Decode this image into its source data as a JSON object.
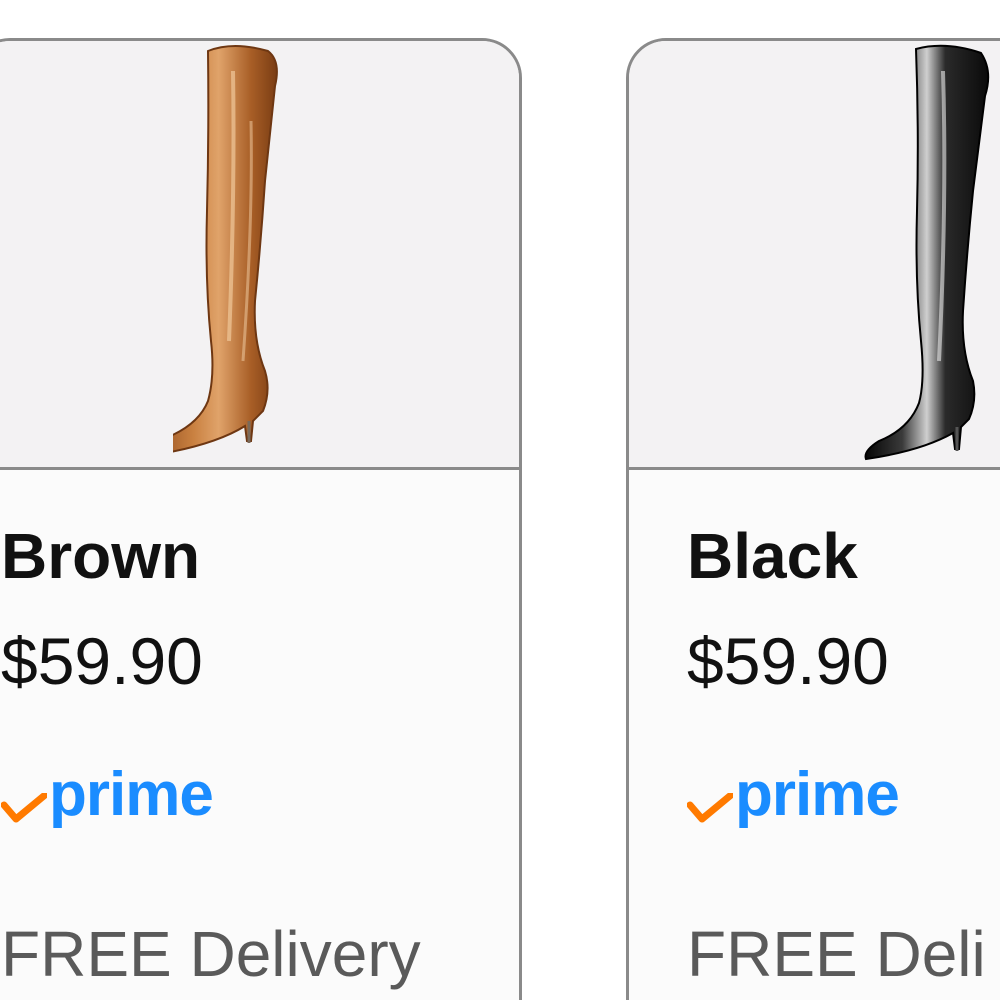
{
  "variants": [
    {
      "color_name": "Brown",
      "price": "$59.90",
      "prime_label": "prime",
      "delivery_label": "FREE Delivery",
      "boot_color": "#b36a2e"
    },
    {
      "color_name": "Black",
      "price": "$59.90",
      "prime_label": "prime",
      "delivery_label": "FREE Deli",
      "boot_color": "#1a1a1a"
    }
  ],
  "colors": {
    "prime_blue": "#1a8cff",
    "prime_check": "#ff7a00",
    "card_border": "#8a8a8a",
    "image_background": "#f3f2f3"
  }
}
